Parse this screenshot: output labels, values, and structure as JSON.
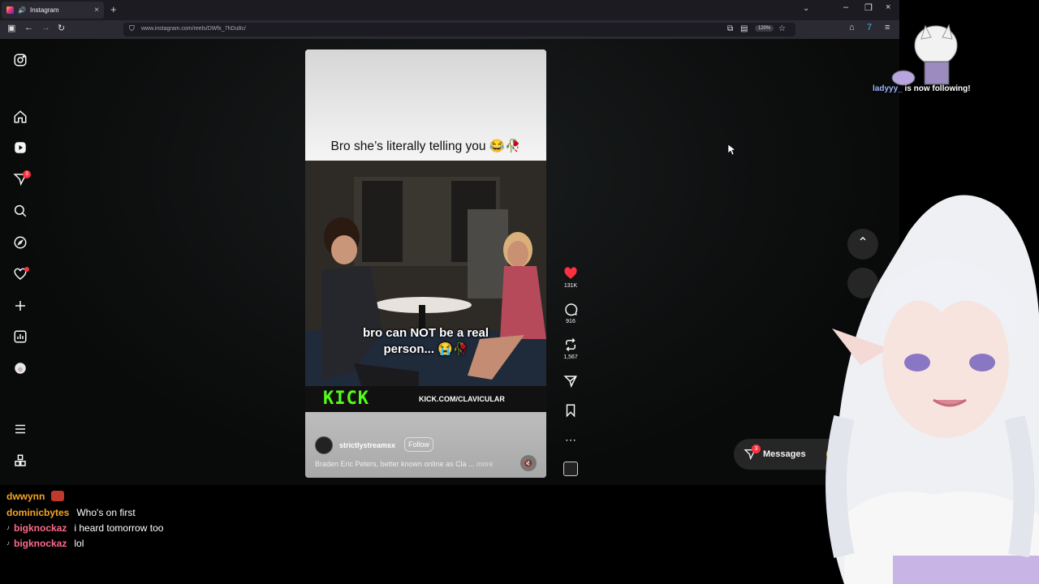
{
  "browser": {
    "tab_title": "Instagram",
    "new_tab": "+",
    "tab_close": "×",
    "url": "www.instagram.com/reels/DWfx_7hDu8c/",
    "zoom": "120%",
    "window_controls": {
      "minimize": "–",
      "restore": "❐",
      "close": "×"
    }
  },
  "instagram": {
    "sidebar": {
      "items": [
        "instagram-logo",
        "home-icon",
        "reels-icon",
        "messages-icon",
        "search-icon",
        "explore-icon",
        "notifications-icon",
        "create-icon",
        "dashboard-icon",
        "profile-avatar",
        "more-icon",
        "also-from-meta-icon"
      ],
      "messages_badge": "3"
    },
    "reel": {
      "caption": "Bro she’s literally telling you 😂🥀",
      "subtitle_line1": "bro can NOT be a real",
      "subtitle_line2": "person... 😭🥀",
      "kick_logo": "KICK",
      "kick_url": "KICK.COM/CLAVICULAR",
      "username": "strictlystreamsx",
      "follow_label": "Follow",
      "description": "Braden Eric Peters, better known online as Cla ...",
      "more_label": "more"
    },
    "actions": {
      "likes": "131K",
      "comments": "916",
      "reposts": "1,567"
    },
    "messages": {
      "label": "Messages",
      "badge": "3"
    }
  },
  "chat": [
    {
      "user": "dwwynn",
      "color": "#f5a623",
      "message": "",
      "badge": ""
    },
    {
      "user": "dominicbytes",
      "color": "#f5a623",
      "message": "Who's on first",
      "badge": ""
    },
    {
      "user": "bigknockaz",
      "color": "#ff6b8a",
      "message": "i heard tomorrow too",
      "badge": "♪"
    },
    {
      "user": "bigknockaz",
      "color": "#ff6b8a",
      "message": "lol",
      "badge": "♪"
    }
  ],
  "overlay": {
    "follower_name": "ladyyy_",
    "follow_text": " is now following!"
  },
  "colors": {
    "like_red": "#ff3040",
    "kick_green": "#53fc18",
    "browser_bg": "#2b2a33"
  }
}
